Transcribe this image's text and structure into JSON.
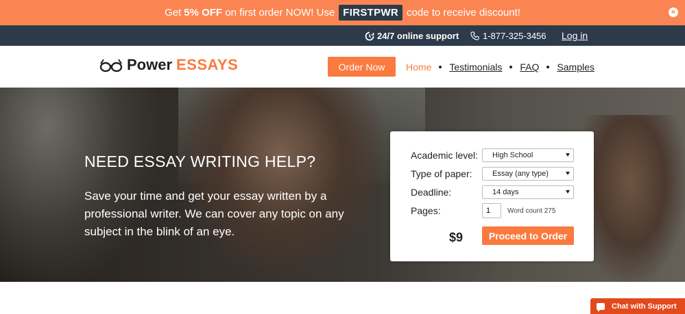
{
  "promo": {
    "prefix": "Get ",
    "discount": "5% OFF",
    "middle": " on first order NOW! Use",
    "code": "FIRSTPWR",
    "suffix": "code to receive discount!",
    "close_glyph": "×"
  },
  "topbar": {
    "support": "24/7 online support",
    "phone": "1-877-325-3456",
    "login": "Log in"
  },
  "header": {
    "logo_power": "Power",
    "logo_essays": "ESSAYS",
    "order_button": "Order Now",
    "nav": [
      "Home",
      "Testimonials",
      "FAQ",
      "Samples"
    ]
  },
  "hero": {
    "title": "NEED ESSAY WRITING HELP?",
    "subtitle": "Save your time and get your essay written by a professional writer. We can cover any topic on any subject in the blink of an eye."
  },
  "order_form": {
    "academic_level_label": "Academic level:",
    "academic_level_value": "High School",
    "paper_type_label": "Type of paper:",
    "paper_type_value": "Essay (any type)",
    "deadline_label": "Deadline:",
    "deadline_value": "14 days",
    "pages_label": "Pages:",
    "pages_value": "1",
    "word_count": "Word count 275",
    "price": "$9",
    "proceed_button": "Proceed to Order"
  },
  "chat": {
    "label": "Chat with Support"
  },
  "colors": {
    "accent": "#fb7a3f",
    "promo_bg": "#fb8552",
    "dark_bar": "#2d3a4a",
    "chat_bg": "#e24a1e"
  }
}
